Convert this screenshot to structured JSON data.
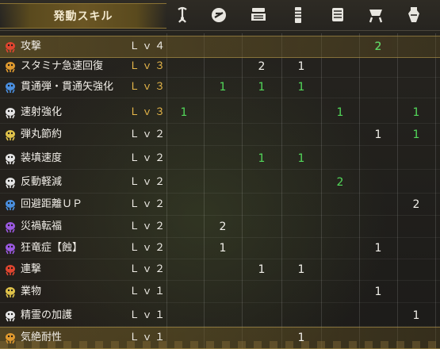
{
  "header": {
    "title": "発動スキル",
    "columns": [
      {
        "icon": "weapon-hook-icon"
      },
      {
        "icon": "charm-icon"
      },
      {
        "icon": "helmet-icon"
      },
      {
        "icon": "chest-armor-icon"
      },
      {
        "icon": "gauntlet-icon"
      },
      {
        "icon": "waist-armor-icon"
      },
      {
        "icon": "leg-armor-icon"
      }
    ]
  },
  "colors": {
    "level_white": "#efece6",
    "level_gold": "#e8b84a",
    "count_white": "#f2f0ea",
    "count_green": "#53d95a",
    "highlight": "#7a6228"
  },
  "skills": [
    {
      "name": "攻撃",
      "level": "Ｌｖ４",
      "level_color": "white",
      "highlight": true,
      "icon_color": "#e0452f",
      "cells": [
        "",
        "",
        "",
        "",
        "",
        "2",
        ""
      ],
      "cell_colors": [
        "",
        "",
        "",
        "",
        "",
        "white",
        ""
      ],
      "extra": {
        "col": 6,
        "value": "2",
        "color": "green"
      }
    },
    {
      "name": "スタミナ急速回復",
      "level": "Ｌｖ３",
      "level_color": "gold",
      "highlight": false,
      "icon_color": "#e09a2f",
      "cells": [
        "",
        "",
        "2",
        "1",
        "",
        "",
        ""
      ],
      "cell_colors": [
        "",
        "",
        "white",
        "white",
        "",
        "",
        ""
      ]
    },
    {
      "name": "貫通弾・貫通矢強化",
      "level": "Ｌｖ３",
      "level_color": "gold",
      "highlight": false,
      "icon_color": "#4a8fe0",
      "cells": [
        "",
        "1",
        "1",
        "1",
        "",
        "",
        ""
      ],
      "cell_colors": [
        "",
        "green",
        "green",
        "green",
        "",
        "",
        ""
      ]
    },
    {
      "name": "速射強化",
      "level": "Ｌｖ３",
      "level_color": "gold",
      "highlight": false,
      "icon_color": "#e6e6e6",
      "cells": [
        "1",
        "",
        "",
        "",
        "1",
        "",
        "1"
      ],
      "cell_colors": [
        "green",
        "",
        "",
        "",
        "green",
        "",
        "green"
      ]
    },
    {
      "name": "弾丸節約",
      "level": "Ｌｖ２",
      "level_color": "white",
      "highlight": false,
      "icon_color": "#e0c34a",
      "cells": [
        "",
        "",
        "",
        "",
        "",
        "1",
        "1"
      ],
      "cell_colors": [
        "",
        "",
        "",
        "",
        "",
        "white",
        "green"
      ]
    },
    {
      "name": "装填速度",
      "level": "Ｌｖ２",
      "level_color": "white",
      "highlight": false,
      "icon_color": "#e6e6e6",
      "cells": [
        "",
        "",
        "1",
        "1",
        "",
        "",
        ""
      ],
      "cell_colors": [
        "",
        "",
        "green",
        "green",
        "",
        "",
        ""
      ]
    },
    {
      "name": "反動軽減",
      "level": "Ｌｖ２",
      "level_color": "white",
      "highlight": false,
      "icon_color": "#e6e6e6",
      "cells": [
        "",
        "",
        "",
        "",
        "2",
        "",
        ""
      ],
      "cell_colors": [
        "",
        "",
        "",
        "",
        "green",
        "",
        ""
      ]
    },
    {
      "name": "回避距離ＵＰ",
      "level": "Ｌｖ２",
      "level_color": "white",
      "highlight": false,
      "icon_color": "#4a8fe0",
      "cells": [
        "",
        "",
        "",
        "",
        "",
        "",
        "2"
      ],
      "cell_colors": [
        "",
        "",
        "",
        "",
        "",
        "",
        "white"
      ]
    },
    {
      "name": "災禍転福",
      "level": "Ｌｖ２",
      "level_color": "white",
      "highlight": false,
      "icon_color": "#9b59e0",
      "cells": [
        "",
        "2",
        "",
        "",
        "",
        "",
        ""
      ],
      "cell_colors": [
        "",
        "white",
        "",
        "",
        "",
        "",
        ""
      ]
    },
    {
      "name": "狂竜症【蝕】",
      "level": "Ｌｖ２",
      "level_color": "white",
      "highlight": false,
      "icon_color": "#9b59e0",
      "cells": [
        "",
        "1",
        "",
        "",
        "",
        "1",
        ""
      ],
      "cell_colors": [
        "",
        "white",
        "",
        "",
        "",
        "white",
        ""
      ]
    },
    {
      "name": "連撃",
      "level": "Ｌｖ２",
      "level_color": "white",
      "highlight": false,
      "icon_color": "#e0452f",
      "cells": [
        "",
        "",
        "1",
        "1",
        "",
        "",
        ""
      ],
      "cell_colors": [
        "",
        "",
        "white",
        "white",
        "",
        "",
        ""
      ]
    },
    {
      "name": "業物",
      "level": "Ｌｖ１",
      "level_color": "white",
      "highlight": false,
      "icon_color": "#e0c34a",
      "cells": [
        "",
        "",
        "",
        "",
        "",
        "1",
        ""
      ],
      "cell_colors": [
        "",
        "",
        "",
        "",
        "",
        "white",
        ""
      ]
    },
    {
      "name": "精霊の加護",
      "level": "Ｌｖ１",
      "level_color": "white",
      "highlight": false,
      "icon_color": "#e6e6e6",
      "cells": [
        "",
        "",
        "",
        "",
        "",
        "",
        "1"
      ],
      "cell_colors": [
        "",
        "",
        "",
        "",
        "",
        "",
        "white"
      ]
    },
    {
      "name": "気絶耐性",
      "level": "Ｌｖ１",
      "level_color": "white",
      "highlight": true,
      "icon_color": "#e09a2f",
      "cells": [
        "",
        "",
        "",
        "1",
        "",
        "",
        ""
      ],
      "cell_colors": [
        "",
        "",
        "",
        "white",
        "",
        "",
        ""
      ]
    }
  ]
}
